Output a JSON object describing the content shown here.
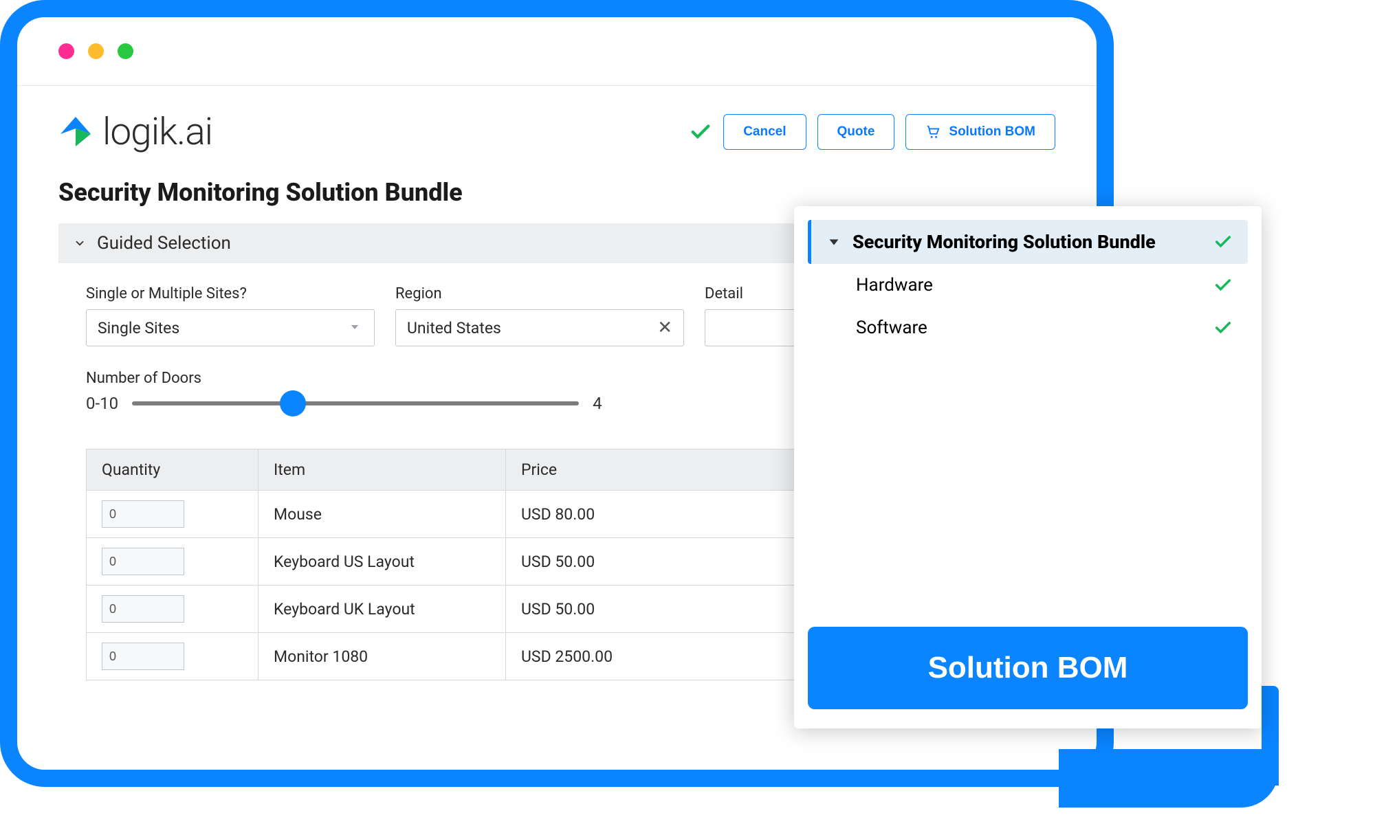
{
  "brand": "logik.ai",
  "header": {
    "cancel": "Cancel",
    "quote": "Quote",
    "solution_bom": "Solution BOM"
  },
  "page_title": "Security Monitoring Solution Bundle",
  "guided_selection": {
    "title": "Guided Selection",
    "fields": {
      "sites_label": "Single or Multiple Sites?",
      "sites_value": "Single Sites",
      "region_label": "Region",
      "region_value": "United States",
      "detail_label": "Detail",
      "detail_value": ""
    },
    "doors": {
      "label": "Number of Doors",
      "range": "0-10",
      "value": "4"
    }
  },
  "table": {
    "columns": {
      "qty": "Quantity",
      "item": "Item",
      "price": "Price"
    },
    "rows": [
      {
        "qty": "0",
        "item": "Mouse",
        "price": "USD 80.00"
      },
      {
        "qty": "0",
        "item": "Keyboard US Layout",
        "price": "USD 50.00"
      },
      {
        "qty": "0",
        "item": "Keyboard UK Layout",
        "price": "USD 50.00"
      },
      {
        "qty": "0",
        "item": "Monitor 1080",
        "price": "USD 2500.00"
      }
    ]
  },
  "panel": {
    "title": "Security Monitoring Solution Bundle",
    "items": [
      "Hardware",
      "Software"
    ],
    "cta": "Solution BOM"
  }
}
